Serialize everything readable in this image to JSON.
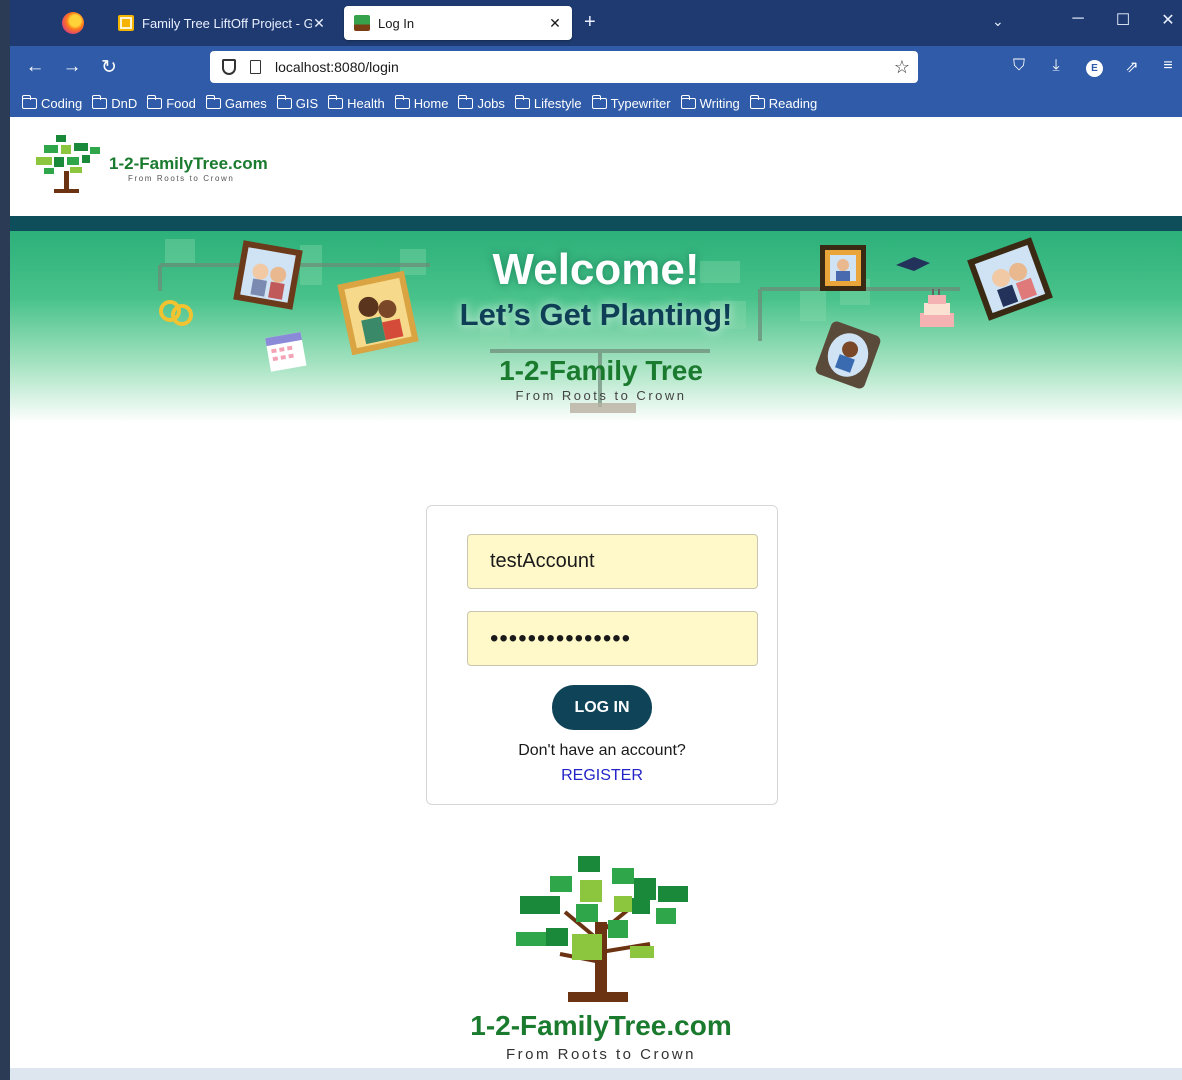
{
  "browser": {
    "tabs": [
      {
        "title": "Family Tree LiftOff Project - Goo",
        "close": "✕"
      },
      {
        "title": "Log In",
        "close": "✕"
      }
    ],
    "new_tab": "+",
    "tabs_dropdown": "⌄",
    "window_buttons": {
      "minimize": "─",
      "maximize": "☐",
      "close": "✕"
    },
    "nav": {
      "back": "←",
      "forward": "→",
      "reload": "↻"
    },
    "url": "localhost:8080/login",
    "bookmark_star": "☆",
    "toolbar": {
      "pocket": "⛉",
      "download": "⤓",
      "extension": "E",
      "share": "⇗",
      "menu": "≡"
    },
    "bookmarks": [
      "Coding",
      "DnD",
      "Food",
      "Games",
      "GIS",
      "Health",
      "Home",
      "Jobs",
      "Lifestyle",
      "Typewriter",
      "Writing",
      "Reading"
    ]
  },
  "header": {
    "brand": "1-2-FamilyTree.com",
    "tagline": "From Roots to Crown"
  },
  "banner": {
    "welcome": "Welcome!",
    "subtitle": "Let’s Get Planting!",
    "brand": "1-2-Family Tree",
    "tagline": "From Roots to Crown"
  },
  "login": {
    "username_value": "testAccount",
    "password_mask": "•••••••••••••••",
    "button": "LOG IN",
    "no_account": "Don't have an account?",
    "register": "REGISTER"
  },
  "footer": {
    "brand": "1-2-FamilyTree.com",
    "tagline": "From Roots to Crown"
  },
  "colors": {
    "tabbar": "#1e3a70",
    "navbar": "#2f5ba8",
    "teal_strip": "#0e4e5a",
    "login_button": "#0f4358",
    "field_bg": "#fff9c9",
    "brand_green": "#1a7a2e",
    "register_link": "#2323c8"
  }
}
